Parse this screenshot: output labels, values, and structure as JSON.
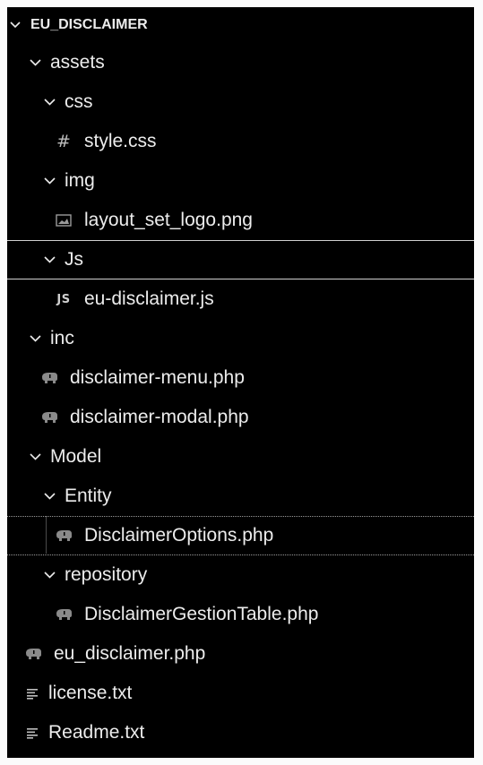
{
  "explorer": {
    "root": "EU_DISCLAIMER",
    "items": [
      {
        "label": "assets",
        "type": "folder"
      },
      {
        "label": "css",
        "type": "folder"
      },
      {
        "label": "style.css",
        "type": "css"
      },
      {
        "label": "img",
        "type": "folder"
      },
      {
        "label": "layout_set_logo.png",
        "type": "image"
      },
      {
        "label": "Js",
        "type": "folder"
      },
      {
        "label": "eu-disclaimer.js",
        "type": "js"
      },
      {
        "label": "inc",
        "type": "folder"
      },
      {
        "label": "disclaimer-menu.php",
        "type": "php"
      },
      {
        "label": "disclaimer-modal.php",
        "type": "php"
      },
      {
        "label": "Model",
        "type": "folder"
      },
      {
        "label": "Entity",
        "type": "folder"
      },
      {
        "label": "DisclaimerOptions.php",
        "type": "php"
      },
      {
        "label": "repository",
        "type": "folder"
      },
      {
        "label": "DisclaimerGestionTable.php",
        "type": "php"
      },
      {
        "label": "eu_disclaimer.php",
        "type": "php"
      },
      {
        "label": "license.txt",
        "type": "text"
      },
      {
        "label": "Readme.txt",
        "type": "text"
      }
    ]
  },
  "icons": {
    "folder_open": "chevron-down-icon",
    "css": "hash-icon",
    "image": "image-file-icon",
    "js": "js-file-icon",
    "php": "php-elephant-icon",
    "text": "text-lines-icon",
    "js_glyph": "JS",
    "css_glyph": "#"
  },
  "colors": {
    "background": "#000000",
    "text": "#ececec",
    "icon": "#9a9a9a",
    "selection_border": "#d0d0d0"
  }
}
